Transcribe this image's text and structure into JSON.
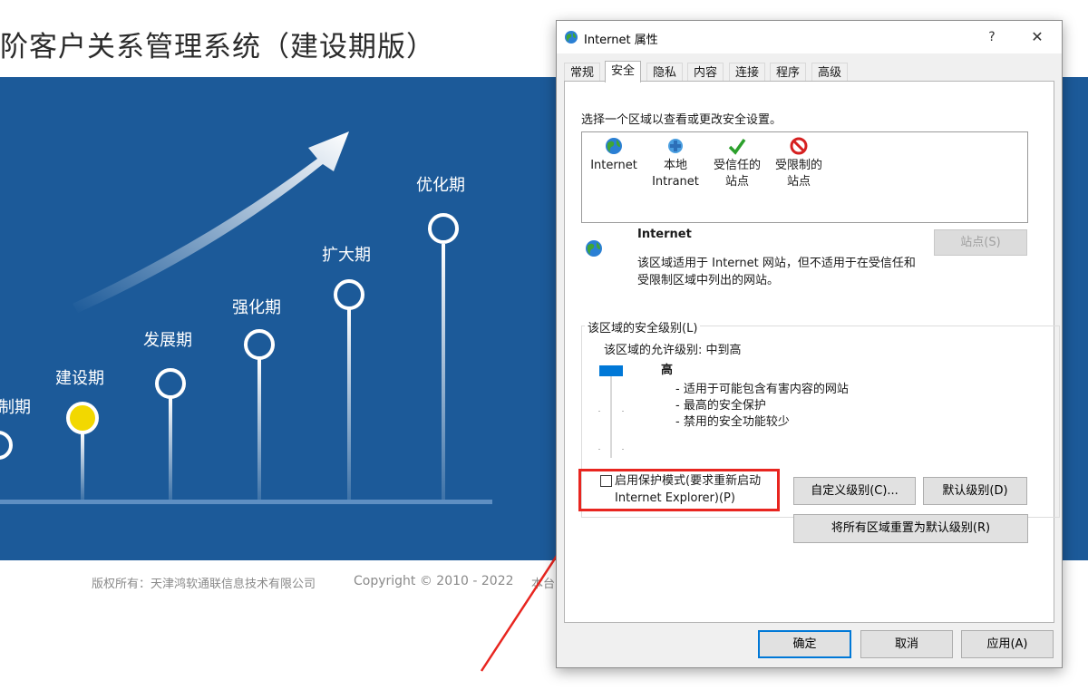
{
  "background_page": {
    "title": "阶客户关系管理系统（建设期版）",
    "banner_color": "#1c5a99",
    "stages": [
      "制期",
      "建设期",
      "发展期",
      "强化期",
      "扩大期",
      "优化期"
    ],
    "active_stage": "建设期",
    "active_color": "#f2d800",
    "footer": {
      "copyright_owner": "版权所有：天津鸿软通联信息技术有限公司",
      "copyright_years": "Copyright © 2010 - 2022",
      "truncated": "本台"
    }
  },
  "dialog": {
    "title": "Internet 属性",
    "help_label": "?",
    "close_label": "✕",
    "tabs": [
      "常规",
      "安全",
      "隐私",
      "内容",
      "连接",
      "程序",
      "高级"
    ],
    "active_tab": "安全",
    "zone_instruction": "选择一个区域以查看或更改安全设置。",
    "zones": [
      {
        "line1": "Internet",
        "line2": "",
        "icon": "globe-icon"
      },
      {
        "line1": "本地",
        "line2": "Intranet",
        "icon": "network-icon"
      },
      {
        "line1": "受信任的",
        "line2": "站点",
        "icon": "check-icon"
      },
      {
        "line1": "受限制的",
        "line2": "站点",
        "icon": "no-entry-icon"
      }
    ],
    "selected_zone": {
      "title": "Internet",
      "description_line1": "该区域适用于 Internet 网站，但不适用于在受信任和",
      "description_line2": "受限制区域中列出的网站。",
      "sites_button": "站点(S)"
    },
    "security_level": {
      "group_label": "该区域的安全级别(L)",
      "allowed_levels": "该区域的允许级别: 中到高",
      "level_name": "高",
      "level_fraction": 1.0,
      "bullets": [
        "- 适用于可能包含有害内容的网站",
        "- 最高的安全保护",
        "- 禁用的安全功能较少"
      ]
    },
    "protected_mode": {
      "checked": false,
      "label_line1": "启用保护模式(要求重新启动",
      "label_line2": "Internet Explorer)(P)"
    },
    "buttons": {
      "custom_level": "自定义级别(C)...",
      "default_level": "默认级别(D)",
      "reset_all": "将所有区域重置为默认级别(R)",
      "ok": "确定",
      "cancel": "取消",
      "apply": "应用(A)"
    },
    "highlight_color": "#e8251f"
  }
}
